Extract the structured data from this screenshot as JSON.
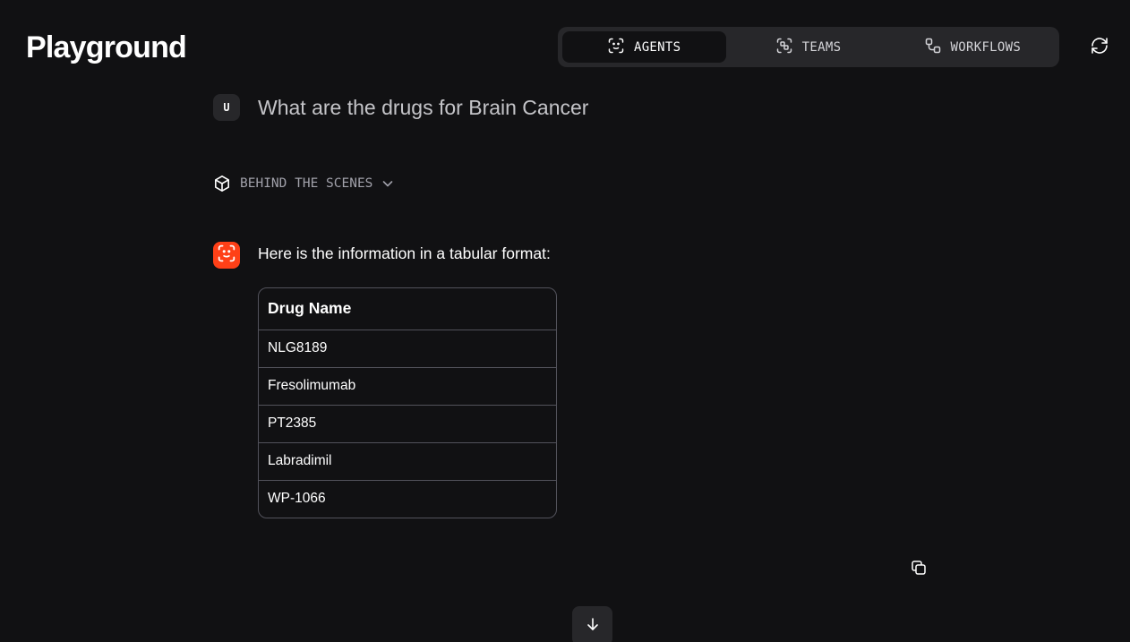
{
  "app": {
    "title": "Playground"
  },
  "mode_tabs": [
    {
      "label": "AGENTS",
      "icon": "agent-icon",
      "active": true
    },
    {
      "label": "TEAMS",
      "icon": "team-icon",
      "active": false
    },
    {
      "label": "WORKFLOWS",
      "icon": "workflow-icon",
      "active": false
    }
  ],
  "header": {
    "refresh_icon": "refresh-icon"
  },
  "conversation": {
    "user": {
      "avatar_letter": "U",
      "message": "What are the drugs for Brain Cancer"
    },
    "behind_the_scenes": {
      "label": "BEHIND THE SCENES",
      "icon": "cube-icon",
      "toggle_icon": "chevron-down-icon"
    },
    "agent": {
      "avatar_icon": "agent-icon",
      "message": "Here is the information in a tabular format:",
      "table": {
        "headers": [
          "Drug Name"
        ],
        "rows": [
          [
            "NLG8189"
          ],
          [
            "Fresolimumab"
          ],
          [
            "PT2385"
          ],
          [
            "Labradimil"
          ],
          [
            "WP-1066"
          ]
        ]
      },
      "copy_icon": "copy-icon"
    }
  },
  "scroll_button": {
    "icon": "arrow-down-icon"
  },
  "colors": {
    "background": "#111113",
    "surface": "#27272a",
    "accent": "#ff4017",
    "border": "#52525b",
    "text_primary": "#ffffff",
    "text_muted": "#a1a1aa"
  }
}
